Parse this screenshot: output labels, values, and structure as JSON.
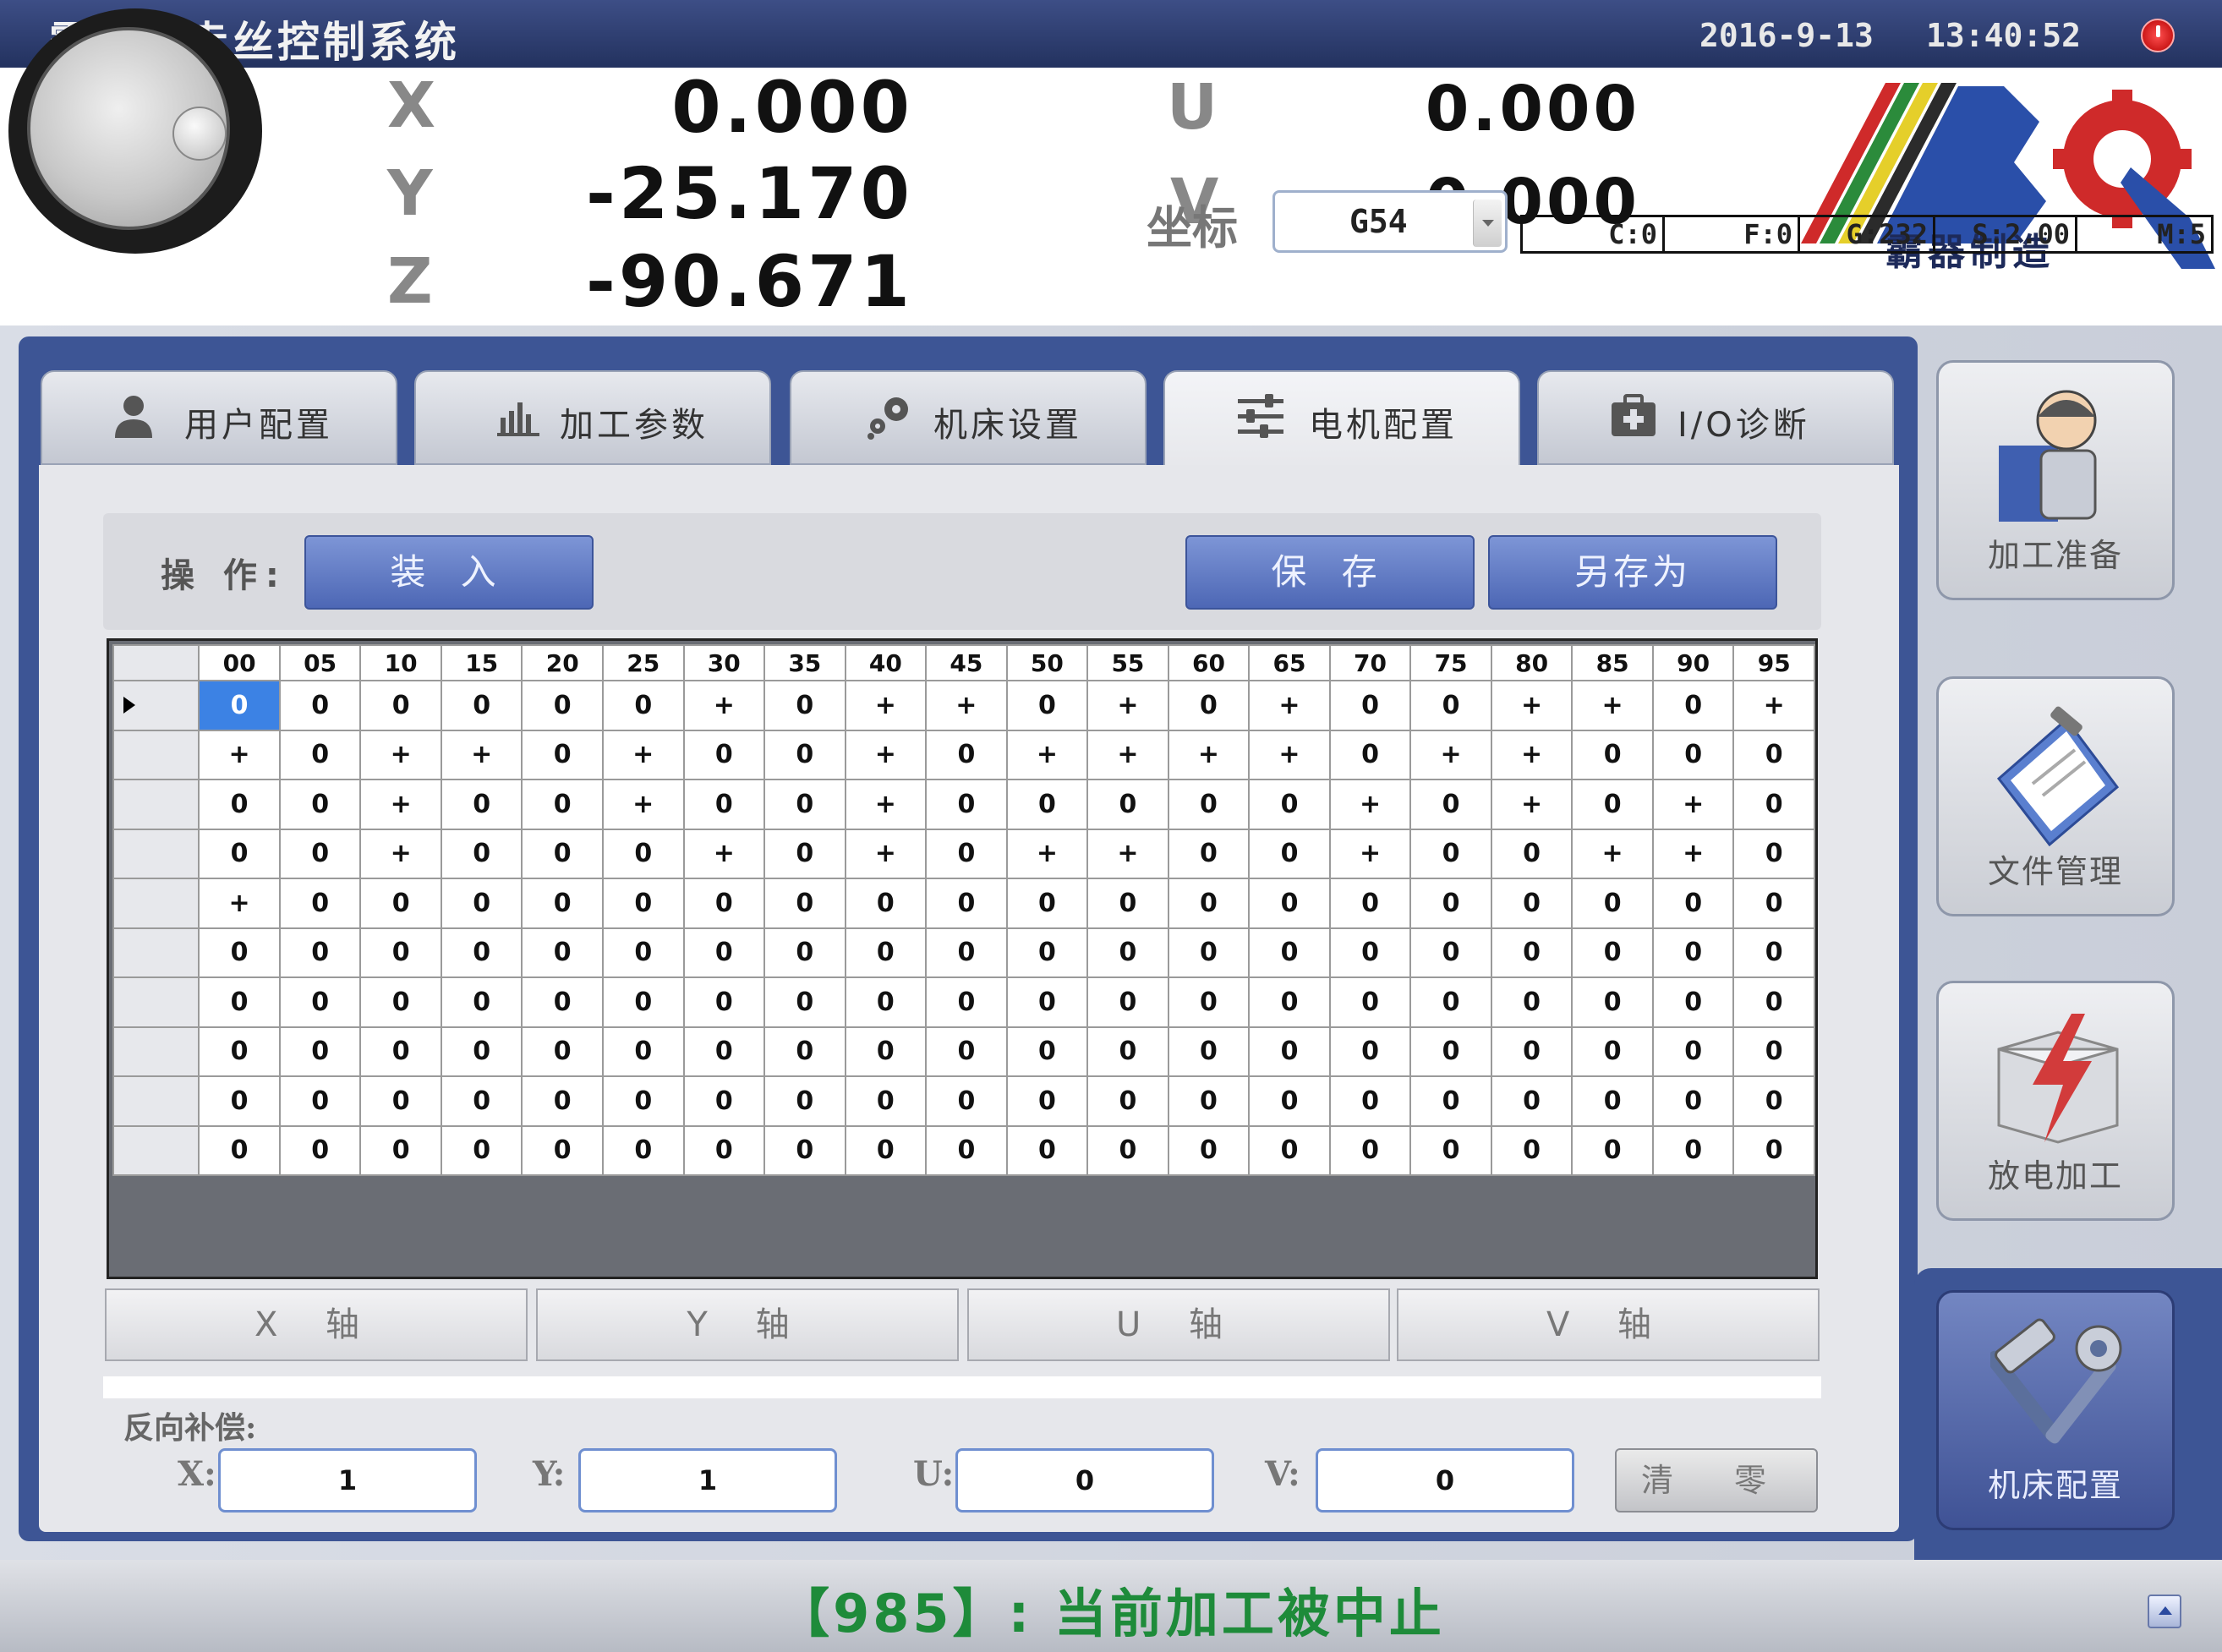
{
  "title": "霸器中走丝控制系统",
  "date": "2016-9-13",
  "time": "13:40:52",
  "coords": {
    "X": "0.000",
    "Y": "-25.170",
    "Z": "-90.671",
    "U": "0.000",
    "V": "0.000",
    "labels": {
      "x": "X",
      "y": "Y",
      "z": "Z",
      "u": "U",
      "v": "V"
    }
  },
  "coord_system": {
    "label": "坐标",
    "value": "G54"
  },
  "status": [
    "C:0",
    "F:0",
    "G:232",
    "S:2.00",
    "M:5"
  ],
  "logo_text": "霸器制造",
  "tabs": [
    {
      "label": "用户配置",
      "icon": "user-icon",
      "active": false
    },
    {
      "label": "加工参数",
      "icon": "bar-chart-icon",
      "active": false
    },
    {
      "label": "机床设置",
      "icon": "gears-icon",
      "active": false
    },
    {
      "label": "电机配置",
      "icon": "sliders-icon",
      "active": true
    },
    {
      "label": "I/O诊断",
      "icon": "medkit-icon",
      "active": false
    }
  ],
  "operation": {
    "label": "操 作:",
    "load": "装 入",
    "save": "保 存",
    "save_as": "另存为"
  },
  "grid": {
    "columns": [
      "00",
      "05",
      "10",
      "15",
      "20",
      "25",
      "30",
      "35",
      "40",
      "45",
      "50",
      "55",
      "60",
      "65",
      "70",
      "75",
      "80",
      "85",
      "90",
      "95"
    ],
    "rows": [
      [
        "0",
        "0",
        "0",
        "0",
        "0",
        "0",
        "+",
        "0",
        "+",
        "+",
        "0",
        "+",
        "0",
        "+",
        "0",
        "0",
        "+",
        "+",
        "0",
        "+"
      ],
      [
        "+",
        "0",
        "+",
        "+",
        "0",
        "+",
        "0",
        "0",
        "+",
        "0",
        "+",
        "+",
        "+",
        "+",
        "0",
        "+",
        "+",
        "0",
        "0",
        "0"
      ],
      [
        "0",
        "0",
        "+",
        "0",
        "0",
        "+",
        "0",
        "0",
        "+",
        "0",
        "0",
        "0",
        "0",
        "0",
        "+",
        "0",
        "+",
        "0",
        "+",
        "0"
      ],
      [
        "0",
        "0",
        "+",
        "0",
        "0",
        "0",
        "+",
        "0",
        "+",
        "0",
        "+",
        "+",
        "0",
        "0",
        "+",
        "0",
        "0",
        "+",
        "+",
        "0"
      ],
      [
        "+",
        "0",
        "0",
        "0",
        "0",
        "0",
        "0",
        "0",
        "0",
        "0",
        "0",
        "0",
        "0",
        "0",
        "0",
        "0",
        "0",
        "0",
        "0",
        "0"
      ],
      [
        "0",
        "0",
        "0",
        "0",
        "0",
        "0",
        "0",
        "0",
        "0",
        "0",
        "0",
        "0",
        "0",
        "0",
        "0",
        "0",
        "0",
        "0",
        "0",
        "0"
      ],
      [
        "0",
        "0",
        "0",
        "0",
        "0",
        "0",
        "0",
        "0",
        "0",
        "0",
        "0",
        "0",
        "0",
        "0",
        "0",
        "0",
        "0",
        "0",
        "0",
        "0"
      ],
      [
        "0",
        "0",
        "0",
        "0",
        "0",
        "0",
        "0",
        "0",
        "0",
        "0",
        "0",
        "0",
        "0",
        "0",
        "0",
        "0",
        "0",
        "0",
        "0",
        "0"
      ],
      [
        "0",
        "0",
        "0",
        "0",
        "0",
        "0",
        "0",
        "0",
        "0",
        "0",
        "0",
        "0",
        "0",
        "0",
        "0",
        "0",
        "0",
        "0",
        "0",
        "0"
      ],
      [
        "0",
        "0",
        "0",
        "0",
        "0",
        "0",
        "0",
        "0",
        "0",
        "0",
        "0",
        "0",
        "0",
        "0",
        "0",
        "0",
        "0",
        "0",
        "0",
        "0"
      ]
    ]
  },
  "axis_tabs": [
    "X 轴",
    "Y 轴",
    "U 轴",
    "V 轴"
  ],
  "compensation": {
    "title": "反向补偿:",
    "x_label": "X:",
    "x_value": "1",
    "y_label": "Y:",
    "y_value": "1",
    "u_label": "U:",
    "u_value": "0",
    "v_label": "V:",
    "v_value": "0",
    "clear": "清 零"
  },
  "sidebar": [
    {
      "label": "加工准备",
      "icon": "worker-icon",
      "active": false
    },
    {
      "label": "文件管理",
      "icon": "clipboard-icon",
      "active": false
    },
    {
      "label": "放电加工",
      "icon": "lightning-box-icon",
      "active": false
    },
    {
      "label": "机床配置",
      "icon": "tools-icon",
      "active": true
    }
  ],
  "message": "【985】: 当前加工被中止",
  "colors": {
    "frame": "#3d5595",
    "button": "#5a74c0",
    "selected_cell": "#3c82e4",
    "message": "#1e8b3a"
  }
}
